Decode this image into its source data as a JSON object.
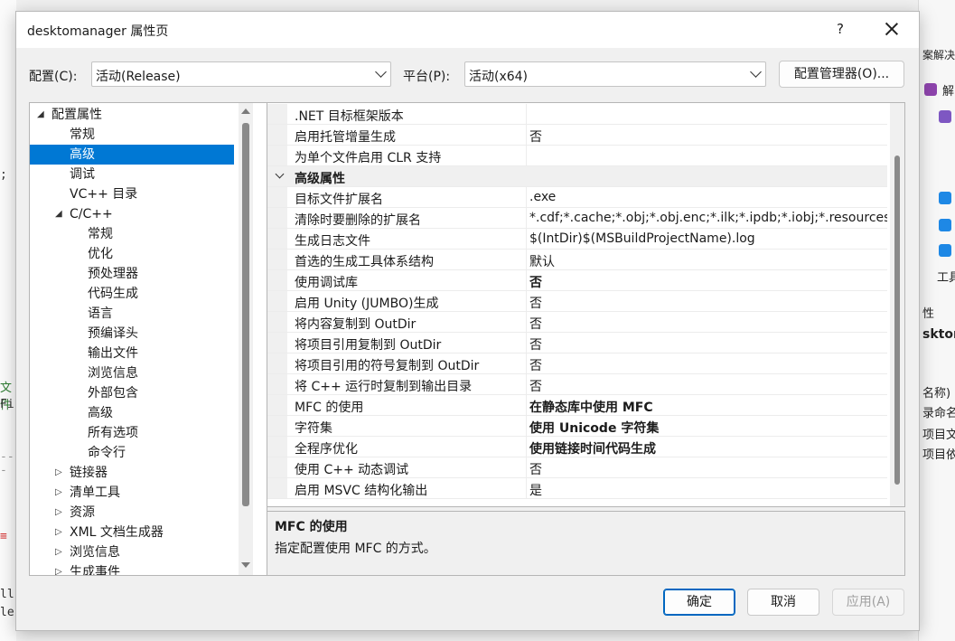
{
  "background": {
    "left_fragments": [
      ";",
      "文件",
      "Fi",
      "---",
      "≡",
      "ll",
      "le"
    ],
    "right_fragments": [
      "案解决方",
      "解",
      "工具",
      "性",
      "sktom",
      "名称)",
      "录命名空",
      "项目文件",
      "项目依赖"
    ]
  },
  "dialog": {
    "title": "desktomanager 属性页",
    "help_label": "?",
    "config_label": "配置(C):",
    "config_value": "活动(Release)",
    "platform_label": "平台(P):",
    "platform_value": "活动(x64)",
    "config_manager_label": "配置管理器(O)..."
  },
  "tree": [
    {
      "label": "配置属性",
      "expander": "◢",
      "level": 0
    },
    {
      "label": "常规",
      "expander": "",
      "level": 1
    },
    {
      "label": "高级",
      "expander": "",
      "level": 1,
      "selected": true
    },
    {
      "label": "调试",
      "expander": "",
      "level": 1
    },
    {
      "label": "VC++ 目录",
      "expander": "",
      "level": 1
    },
    {
      "label": "C/C++",
      "expander": "◢",
      "level": 1
    },
    {
      "label": "常规",
      "expander": "",
      "level": 2
    },
    {
      "label": "优化",
      "expander": "",
      "level": 2
    },
    {
      "label": "预处理器",
      "expander": "",
      "level": 2
    },
    {
      "label": "代码生成",
      "expander": "",
      "level": 2
    },
    {
      "label": "语言",
      "expander": "",
      "level": 2
    },
    {
      "label": "预编译头",
      "expander": "",
      "level": 2
    },
    {
      "label": "输出文件",
      "expander": "",
      "level": 2
    },
    {
      "label": "浏览信息",
      "expander": "",
      "level": 2
    },
    {
      "label": "外部包含",
      "expander": "",
      "level": 2
    },
    {
      "label": "高级",
      "expander": "",
      "level": 2
    },
    {
      "label": "所有选项",
      "expander": "",
      "level": 2
    },
    {
      "label": "命令行",
      "expander": "",
      "level": 2
    },
    {
      "label": "链接器",
      "expander": "▷",
      "level": 1
    },
    {
      "label": "清单工具",
      "expander": "▷",
      "level": 1
    },
    {
      "label": "资源",
      "expander": "▷",
      "level": 1
    },
    {
      "label": "XML 文档生成器",
      "expander": "▷",
      "level": 1
    },
    {
      "label": "浏览信息",
      "expander": "▷",
      "level": 1
    },
    {
      "label": "生成事件",
      "expander": "▷",
      "level": 1
    }
  ],
  "grid": [
    {
      "name": ".NET 目标框架版本",
      "value": "",
      "bold": false
    },
    {
      "name": "启用托管增量生成",
      "value": "否",
      "bold": false
    },
    {
      "name": "为单个文件启用 CLR 支持",
      "value": "",
      "bold": false
    },
    {
      "name": "高级属性",
      "value": "",
      "category": true
    },
    {
      "name": "目标文件扩展名",
      "value": ".exe",
      "bold": false
    },
    {
      "name": "清除时要删除的扩展名",
      "value": "*.cdf;*.cache;*.obj;*.obj.enc;*.ilk;*.ipdb;*.iobj;*.resources;*.tlb;*.tli;*.tlh;*.tmp",
      "bold": false
    },
    {
      "name": "生成日志文件",
      "value": "$(IntDir)$(MSBuildProjectName).log",
      "bold": false
    },
    {
      "name": "首选的生成工具体系结构",
      "value": "默认",
      "bold": false
    },
    {
      "name": "使用调试库",
      "value": "否",
      "bold": true
    },
    {
      "name": "启用 Unity (JUMBO)生成",
      "value": "否",
      "bold": false
    },
    {
      "name": "将内容复制到 OutDir",
      "value": "否",
      "bold": false
    },
    {
      "name": "将项目引用复制到 OutDir",
      "value": "否",
      "bold": false
    },
    {
      "name": "将项目引用的符号复制到 OutDir",
      "value": "否",
      "bold": false
    },
    {
      "name": "将 C++ 运行时复制到输出目录",
      "value": "否",
      "bold": false
    },
    {
      "name": "MFC 的使用",
      "value": "在静态库中使用 MFC",
      "bold": true
    },
    {
      "name": "字符集",
      "value": "使用 Unicode 字符集",
      "bold": true
    },
    {
      "name": "全程序优化",
      "value": "使用链接时间代码生成",
      "bold": true
    },
    {
      "name": "使用 C++ 动态调试",
      "value": "否",
      "bold": false
    },
    {
      "name": "启用 MSVC 结构化输出",
      "value": "是",
      "bold": false
    }
  ],
  "description": {
    "title": "MFC 的使用",
    "text": "指定配置使用 MFC 的方式。"
  },
  "buttons": {
    "ok": "确定",
    "cancel": "取消",
    "apply": "应用(A)"
  },
  "colors": {
    "selection": "#0078d4",
    "accent_border": "#0067c0"
  }
}
